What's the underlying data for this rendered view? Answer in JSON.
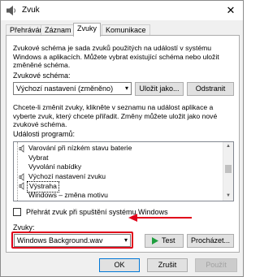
{
  "window": {
    "title": "Zvuk",
    "close_glyph": "✕"
  },
  "tabs": [
    {
      "label": "Přehrávání",
      "active": false
    },
    {
      "label": "Záznam",
      "active": false
    },
    {
      "label": "Zvuky",
      "active": true
    },
    {
      "label": "Komunikace",
      "active": false
    }
  ],
  "scheme": {
    "description": "Zvukové schéma je sada zvuků použitých na událostí v systému Windows a aplikacích. Můžete vybrat existující schéma nebo uložit změněné schéma.",
    "label": "Zvukové schéma:",
    "selected": "Výchozí nastavení (změněno)",
    "save_as_label": "Uložit jako...",
    "remove_label": "Odstranit"
  },
  "events": {
    "description": "Chcete-li změnit zvuky, klikněte v seznamu na událost aplikace a vyberte zvuk, který chcete přiřadit. Změny můžete uložit jako nové zvukové schéma.",
    "label": "Události programů:",
    "items": [
      {
        "label": "Varování při nízkém stavu baterie",
        "has_sound": true,
        "selected": false
      },
      {
        "label": "Vybrat",
        "has_sound": false,
        "selected": false
      },
      {
        "label": "Vyvolání nabídky",
        "has_sound": false,
        "selected": false
      },
      {
        "label": "Výchozí nastavení zvuku",
        "has_sound": true,
        "selected": false
      },
      {
        "label": "Výstraha",
        "has_sound": true,
        "selected": true
      },
      {
        "label": "Windows – změna motivu",
        "has_sound": false,
        "selected": false
      }
    ]
  },
  "startup": {
    "label": "Přehrát zvuk při spuštění systému Windows",
    "checked": false
  },
  "sounds": {
    "label": "Zvuky:",
    "selected": "Windows Background.wav",
    "test_label": "Test",
    "browse_label": "Procházet..."
  },
  "footer": {
    "ok_label": "OK",
    "cancel_label": "Zrušit",
    "apply_label": "Použít"
  },
  "colors": {
    "accent": "#0078d7",
    "highlight_red": "#e0001a",
    "test_icon": "#1e9e3e"
  },
  "icons": {
    "app": "speaker-icon",
    "event": "speaker-icon",
    "test": "play-icon"
  }
}
